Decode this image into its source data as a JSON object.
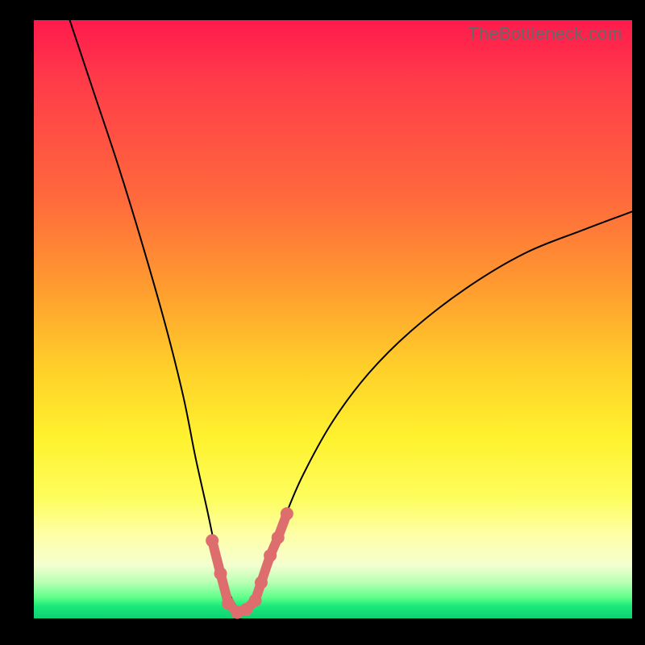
{
  "watermark": "TheBottleneck.com",
  "colors": {
    "page_bg": "#000000",
    "gradient_top": "#ff1a4d",
    "gradient_mid": "#ffcf2a",
    "gradient_bottom": "#0fd173",
    "curve": "#000000",
    "marker": "#de6e6e"
  },
  "chart_data": {
    "type": "line",
    "title": "",
    "xlabel": "",
    "ylabel": "",
    "xlim": [
      0,
      100
    ],
    "ylim": [
      0,
      100
    ],
    "series": [
      {
        "name": "bottleneck-curve",
        "x": [
          6,
          10,
          14,
          18,
          22,
          25,
          27,
          29,
          30.5,
          32,
          33.5,
          35,
          36.5,
          38,
          40,
          42,
          45,
          50,
          56,
          63,
          72,
          82,
          92,
          100
        ],
        "y": [
          100,
          88,
          76,
          63,
          49,
          37,
          27,
          18,
          11,
          6,
          2.5,
          1,
          2,
          5,
          11,
          17,
          24,
          33,
          41,
          48,
          55,
          61,
          65,
          68
        ]
      }
    ],
    "markers": {
      "name": "highlight-points",
      "x": [
        29.8,
        31.2,
        32.5,
        34.0,
        35.5,
        37.0,
        38.0,
        39.5,
        40.8,
        42.3
      ],
      "y": [
        13.0,
        7.5,
        2.5,
        1.0,
        1.5,
        3.0,
        6.0,
        10.5,
        13.5,
        17.5
      ]
    }
  }
}
